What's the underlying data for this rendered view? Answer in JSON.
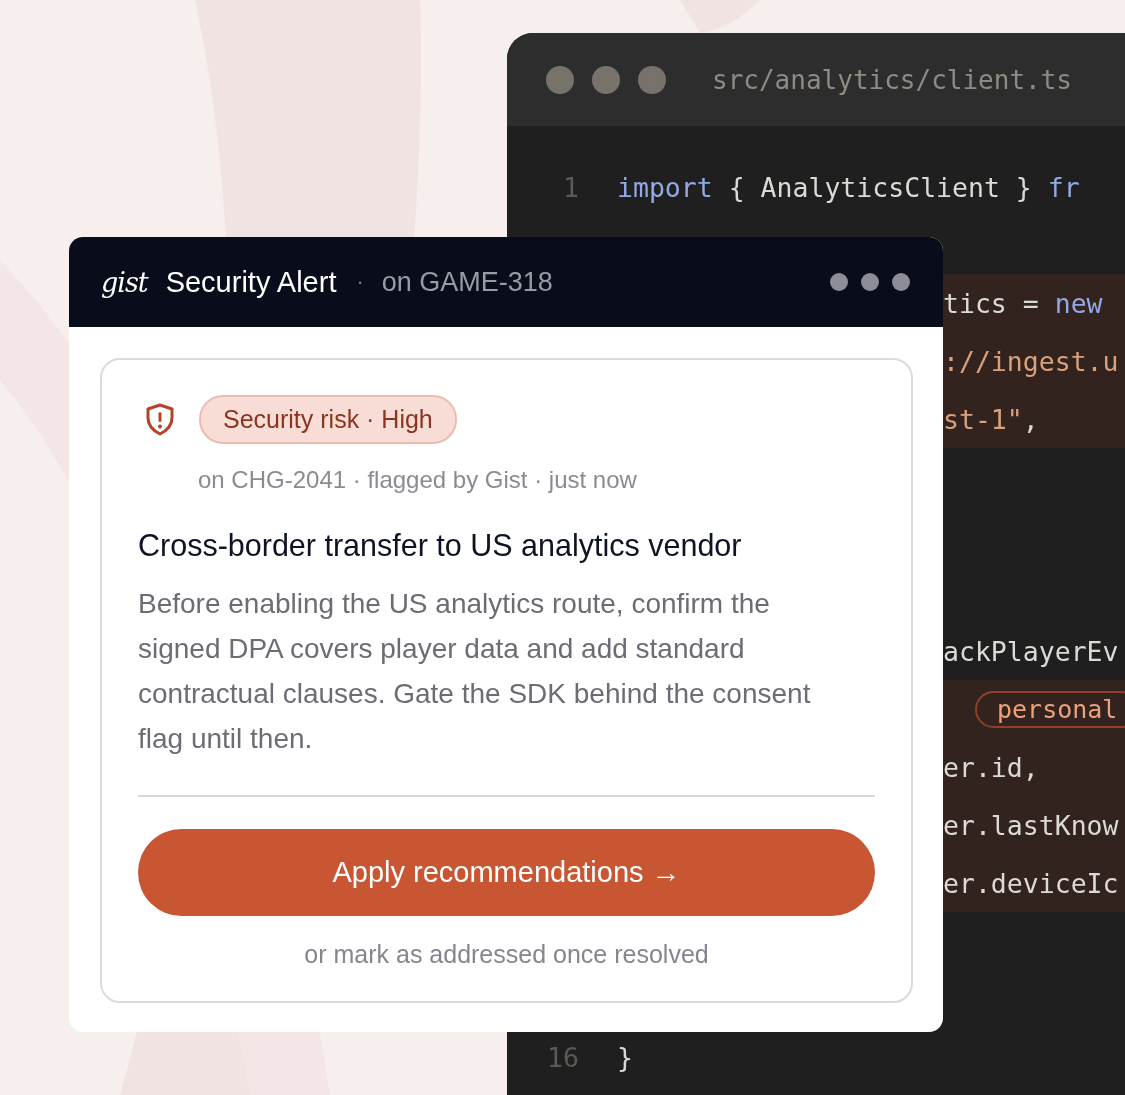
{
  "editor": {
    "filename": "src/analytics/client.ts",
    "lines": [
      {
        "number": "1",
        "highlighted": false,
        "segments": [
          {
            "kind": "keyword",
            "text": "import"
          },
          {
            "kind": "plain",
            "text": " { AnalyticsClient } "
          },
          {
            "kind": "keyword",
            "text": "fr"
          }
        ]
      },
      {
        "highlighted": false
      },
      {
        "highlighted": true,
        "segments": [
          {
            "kind": "plain",
            "text": "tics = "
          },
          {
            "kind": "keyword",
            "text": "new"
          }
        ]
      },
      {
        "highlighted": true,
        "segments": [
          {
            "kind": "string",
            "text": "://ingest.u"
          }
        ]
      },
      {
        "highlighted": true,
        "segments": [
          {
            "kind": "string",
            "text": "st-1\""
          },
          {
            "kind": "plain",
            "text": ","
          }
        ]
      },
      {
        "highlighted": false
      },
      {
        "highlighted": false
      },
      {
        "highlighted": false
      },
      {
        "highlighted": false,
        "segments": [
          {
            "kind": "plain",
            "text": "ackPlayerEv"
          }
        ]
      },
      {
        "highlighted": true,
        "segments": [
          {
            "kind": "tag",
            "text": "personal"
          }
        ]
      },
      {
        "highlighted": true,
        "segments": [
          {
            "kind": "plain",
            "text": "er.id,"
          }
        ]
      },
      {
        "highlighted": true,
        "segments": [
          {
            "kind": "plain",
            "text": "er.lastKnow"
          }
        ]
      },
      {
        "highlighted": true,
        "segments": [
          {
            "kind": "plain",
            "text": "er.deviceIc"
          }
        ]
      },
      {
        "highlighted": false
      },
      {
        "highlighted": false
      },
      {
        "number": "16",
        "highlighted": false,
        "segments": [
          {
            "kind": "plain",
            "text": "}"
          }
        ]
      }
    ]
  },
  "alert": {
    "logo": "gist",
    "title": "Security Alert",
    "separator": "·",
    "context": "on GAME-318",
    "badge": "Security risk · High",
    "meta": "on CHG-2041 · flagged by Gist · just now",
    "heading": "Cross-border transfer to US analytics vendor",
    "body": "Before enabling the US analytics route, confirm the signed DPA covers player data and add standard contractual clauses. Gate the SDK behind the consent flag until then.",
    "button": "Apply recommendations →",
    "footnote": "or mark as addressed once resolved"
  }
}
